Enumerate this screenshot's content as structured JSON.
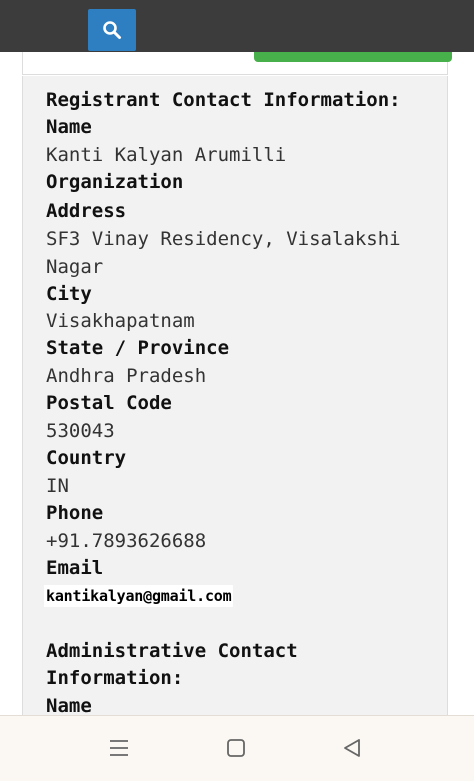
{
  "toolbar": {
    "search_icon": "search-icon",
    "accent": "#2d7fc1"
  },
  "registrant": {
    "heading": "Registrant Contact Information:",
    "name_label": "Name",
    "name_value": "Kanti Kalyan Arumilli",
    "organization_label": "Organization",
    "address_label": "Address",
    "address_value_line1": "SF3 Vinay Residency, Visalakshi",
    "address_value_line2": "Nagar",
    "city_label": "City",
    "city_value": "Visakhapatnam",
    "state_label": "State / Province",
    "state_value": "Andhra Pradesh",
    "postal_label": "Postal Code",
    "postal_value": "530043",
    "country_label": "Country",
    "country_value": "IN",
    "phone_label": "Phone",
    "phone_value": "+91.7893626688",
    "email_label": "Email",
    "email_value": "kantikalyan@gmail.com"
  },
  "administrative": {
    "heading_line1": "Administrative Contact",
    "heading_line2": "Information:",
    "name_label": "Name"
  },
  "navbar": {
    "icons": [
      "menu-icon",
      "home-square-icon",
      "back-triangle-icon"
    ]
  }
}
